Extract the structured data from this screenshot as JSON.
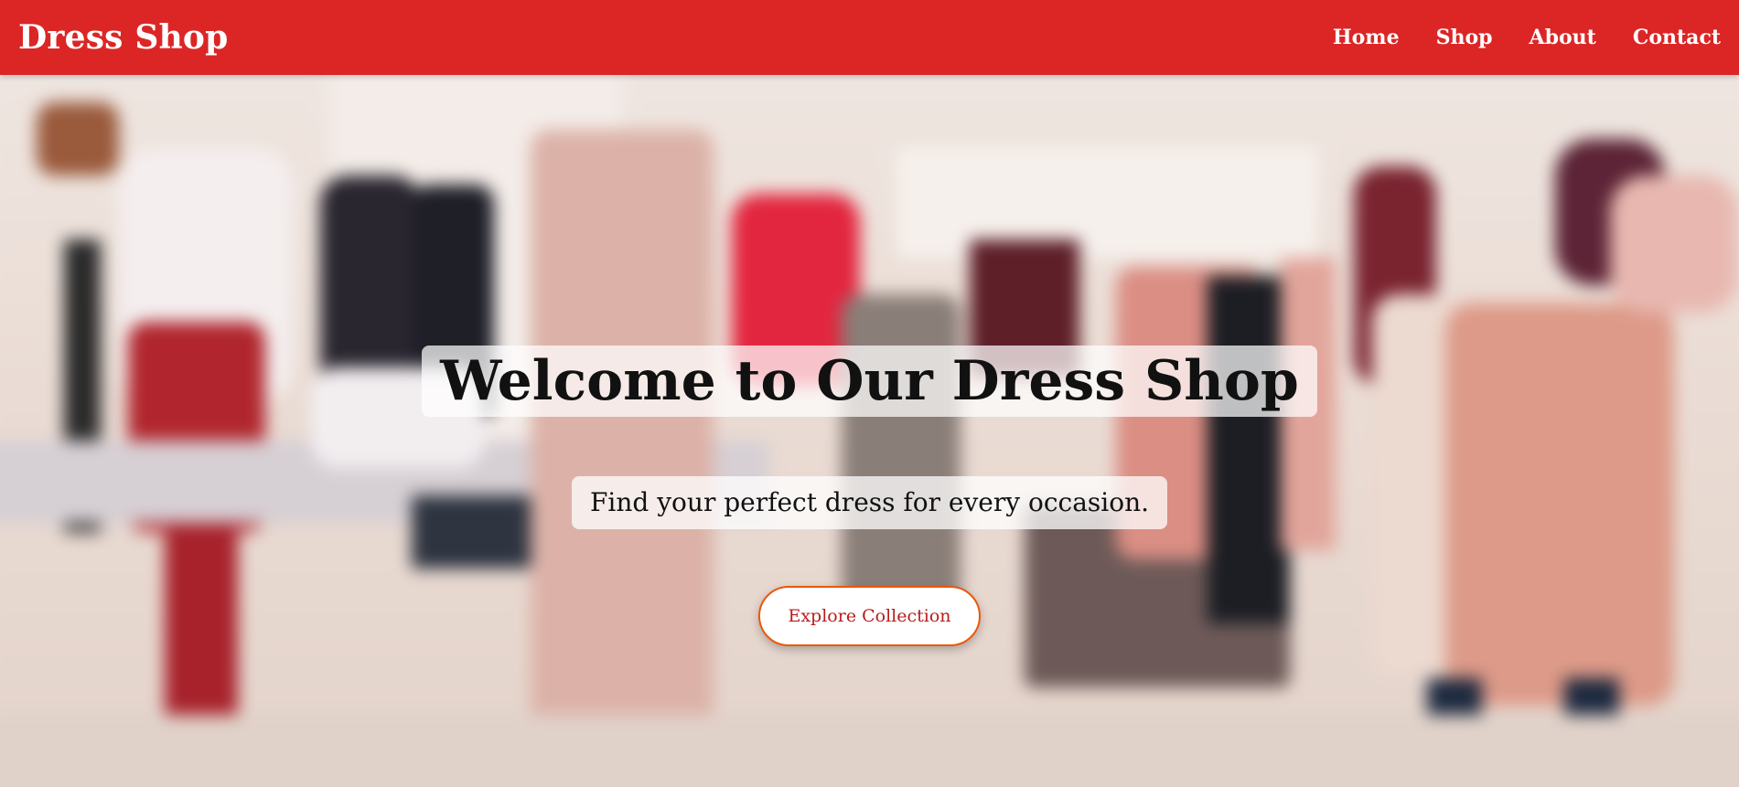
{
  "brand": {
    "name": "Dress Shop",
    "color": "#dc2626"
  },
  "nav": {
    "items": [
      {
        "label": "Home"
      },
      {
        "label": "Shop"
      },
      {
        "label": "About"
      },
      {
        "label": "Contact"
      }
    ]
  },
  "hero": {
    "title": "Welcome to Our Dress Shop",
    "subtitle": "Find your perfect dress for every occasion.",
    "cta_label": "Explore Collection",
    "background": "blurred photo of a clothing boutique with mannequins and dress racks"
  },
  "colors": {
    "accent": "#dc2626",
    "button_border": "#ea580c",
    "button_text": "#b91c1c"
  }
}
